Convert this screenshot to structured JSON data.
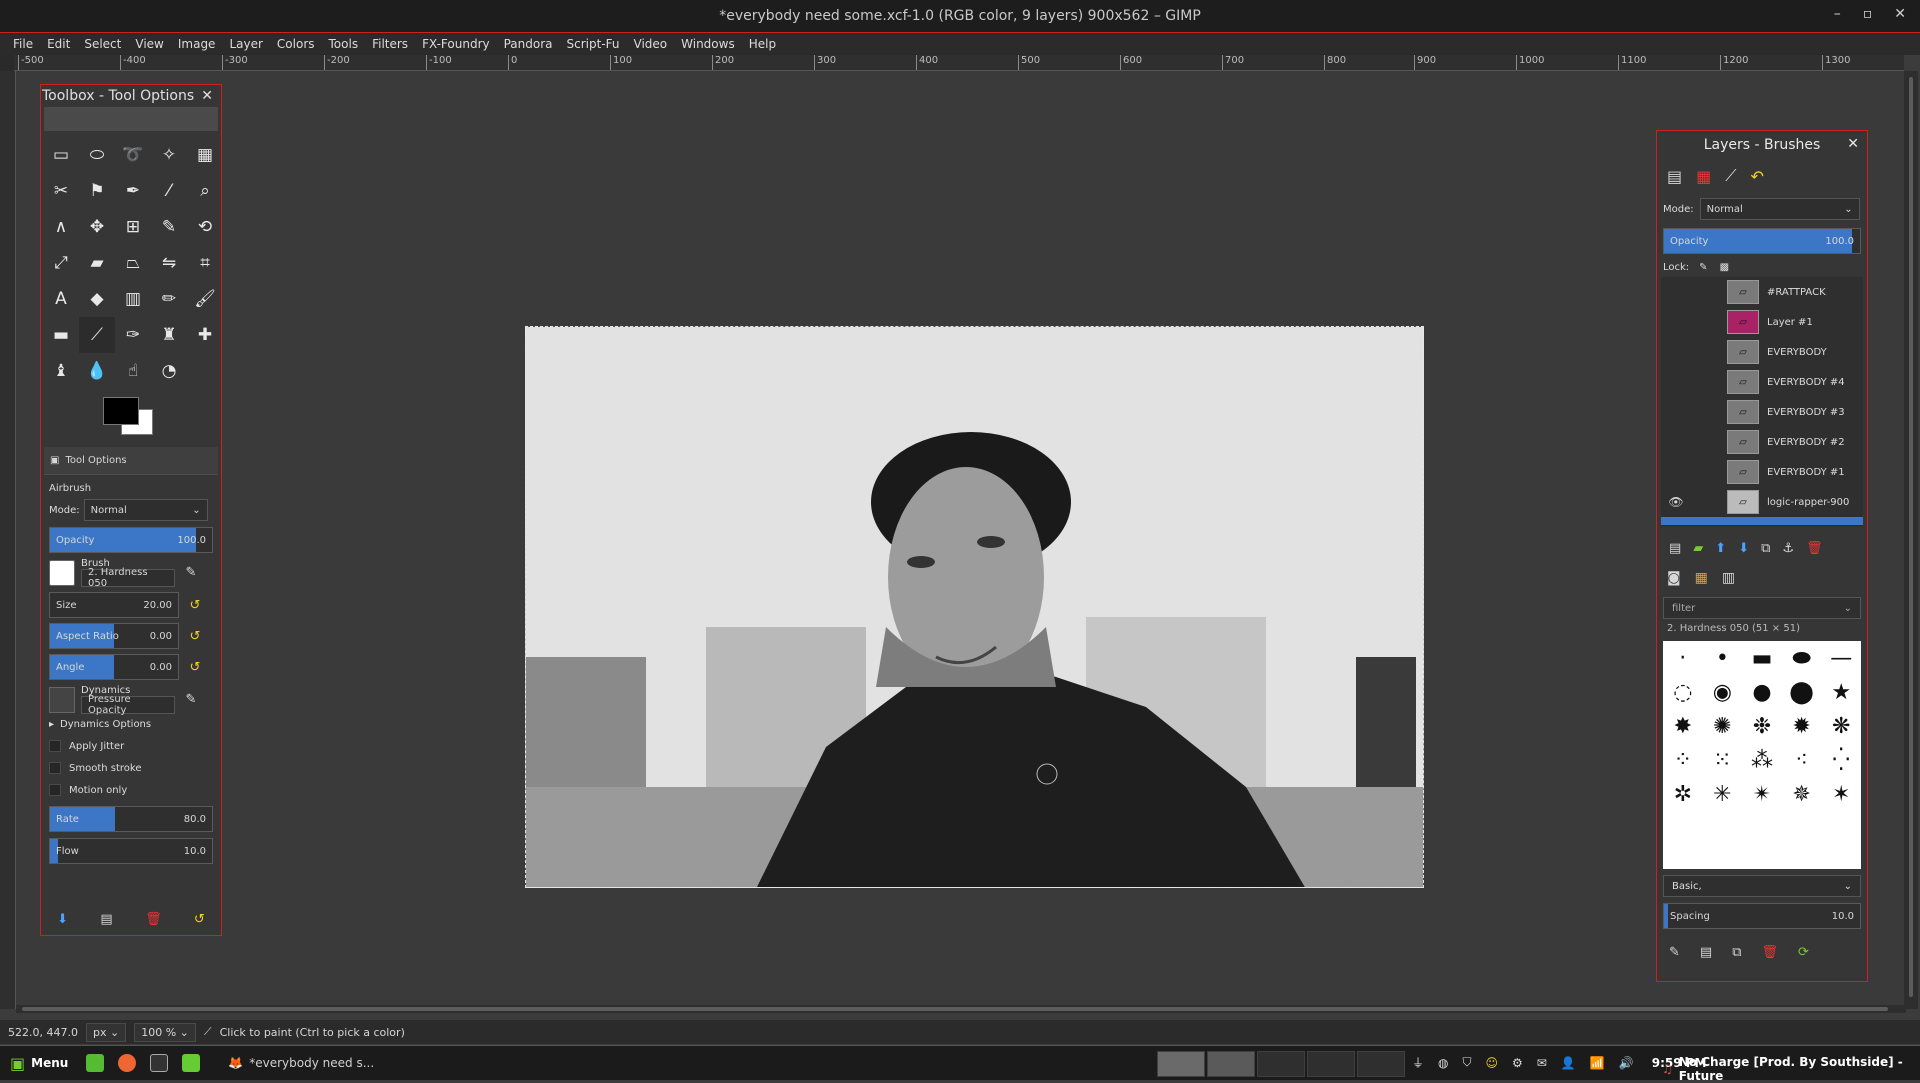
{
  "window": {
    "title": "*everybody need some.xcf-1.0 (RGB color, 9 layers) 900x562 – GIMP",
    "controls": [
      "–",
      "▫",
      "✕"
    ]
  },
  "menubar": [
    "File",
    "Edit",
    "Select",
    "View",
    "Image",
    "Layer",
    "Colors",
    "Tools",
    "Filters",
    "FX-Foundry",
    "Pandora",
    "Script-Fu",
    "Video",
    "Windows",
    "Help"
  ],
  "ruler": {
    "labels": [
      "-500",
      "-400",
      "-300",
      "-200",
      "-100",
      "0",
      "100",
      "200",
      "300",
      "400",
      "500",
      "600",
      "700",
      "800",
      "900",
      "1000",
      "1100",
      "1200",
      "1300"
    ]
  },
  "toolbox": {
    "title": "Toolbox - Tool Options",
    "close": "✕",
    "tab_label": "Tool Options",
    "tool_name": "Airbrush",
    "mode_label": "Mode:",
    "mode_value": "Normal",
    "opacity_label": "Opacity",
    "opacity_value": "100.0",
    "opacity_fill": 1.0,
    "brush_label": "Brush",
    "brush_value": "2. Hardness 050",
    "size_label": "Size",
    "size_value": "20.00",
    "aspect_label": "Aspect Ratio",
    "aspect_value": "0.00",
    "angle_label": "Angle",
    "angle_value": "0.00",
    "dynamics_label": "Dynamics",
    "dynamics_value": "Pressure Opacity",
    "dynamics_options": "Dynamics Options",
    "apply_jitter": "Apply Jitter",
    "smooth_stroke": "Smooth stroke",
    "motion_only": "Motion only",
    "rate_label": "Rate",
    "rate_value": "80.0",
    "rate_fill": 0.4,
    "flow_label": "Flow",
    "flow_value": "10.0",
    "flow_fill": 0.05
  },
  "layers": {
    "title": "Layers - Brushes",
    "mode_label": "Mode:",
    "mode_value": "Normal",
    "opacity_label": "Opacity",
    "opacity_value": "100.0",
    "lock_label": "Lock:",
    "items": [
      {
        "name": "#RATTPACK",
        "visible": false
      },
      {
        "name": "Layer #1",
        "visible": false
      },
      {
        "name": "EVERYBODY",
        "visible": false
      },
      {
        "name": "EVERYBODY #4",
        "visible": false
      },
      {
        "name": "EVERYBODY #3",
        "visible": false
      },
      {
        "name": "EVERYBODY #2",
        "visible": false
      },
      {
        "name": "EVERYBODY #1",
        "visible": false
      },
      {
        "name": "logic-rapper-900",
        "visible": true
      }
    ],
    "filter_placeholder": "filter",
    "brush_selected": "2. Hardness 050 (51 × 51)",
    "brush_set": "Basic,",
    "spacing_label": "Spacing",
    "spacing_value": "10.0"
  },
  "status": {
    "coords": "522.0, 447.0",
    "unit": "px",
    "zoom": "100 %",
    "message": "Click to paint (Ctrl to pick a color)"
  },
  "taskbar": {
    "menu_label": "Menu",
    "window_label": "*everybody need s...",
    "clock": "9:59 PM",
    "now_playing": "No Charge [Prod. By Southside] - Future"
  },
  "colors": {
    "accent": "#cf2020",
    "selection": "#3b77c6",
    "bg": "#3c3c3c"
  }
}
